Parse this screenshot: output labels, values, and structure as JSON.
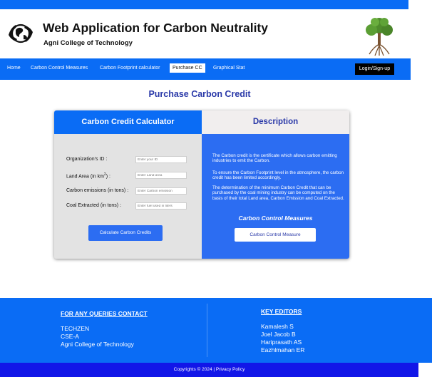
{
  "header": {
    "title": "Web Application for Carbon Neutrality",
    "subtitle": "Agni College of Technology",
    "logo_left_icon": "earth-hands-icon",
    "logo_right_icon": "tree-icon"
  },
  "nav": {
    "items": [
      {
        "label": "Home"
      },
      {
        "label": "Carbon Control Measures"
      },
      {
        "label": "Carbon Footprint calculator"
      },
      {
        "label": "Purchase CC",
        "active": true
      },
      {
        "label": "Graphical Stat"
      }
    ],
    "login_label": "Login/Sign-up"
  },
  "page": {
    "title": "Purchase Carbon Credit"
  },
  "calculator": {
    "heading": "Carbon Credit Calculator",
    "fields": [
      {
        "label": "Organization's ID :",
        "placeholder": "Enter your ID"
      },
      {
        "label_pre": "Land Area (in km",
        "label_sup": "2",
        "label_post": ") :",
        "placeholder": "Enter Land area"
      },
      {
        "label": "Carbon emissions (in tons) :",
        "placeholder": "Enter Carbon emission"
      },
      {
        "label": "Coal Extracted (in tons) :",
        "placeholder": "Enter fuel used in liters"
      }
    ],
    "button_label": "Calculate Carbon Credits"
  },
  "description": {
    "heading": "Description",
    "paragraphs": [
      "The Carbon credit is the certificate which allows carbon emitting industries to emit the Carbon.",
      "To ensure the Carbon Footprint level in the atmosphere, the carbon credit has been limited accordingly.",
      "The determination of the minimum Carbon Credit that can be purchased by the coal mining industry can be computed on the basis of their total Land area, Carbon Emission and Coal Extracted."
    ],
    "measures_title": "Carbon Control Measures",
    "measures_button": "Carbon Control Measure"
  },
  "footer": {
    "contact_heading": "FOR ANY QUERIES CONTACT",
    "contact_lines": [
      "TECHZEN",
      "CSE-A",
      "Agni College of Technology"
    ],
    "editors_heading": "KEY EDITORS",
    "editors": [
      "Kamalesh S",
      "Joel Jacob B",
      "Hariprasath AS",
      "Eazhlmahan ER"
    ],
    "copyright": "Copyrights © 2024 | Privacy Policy"
  },
  "colors": {
    "primary_blue": "#0a6cf5",
    "title_navy": "#2a39a8",
    "bottom_bar": "#1216e8"
  }
}
